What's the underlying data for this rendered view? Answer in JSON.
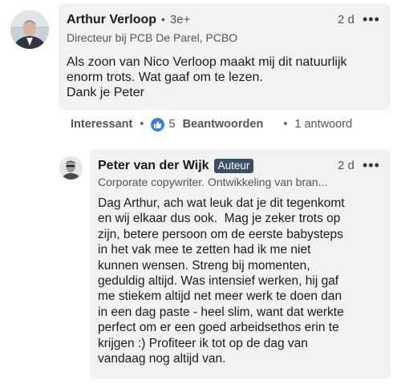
{
  "comment": {
    "author": "Arthur Verloop",
    "separator": "•",
    "degree": "3e+",
    "time": "2 d",
    "more": "•••",
    "headline": "Directeur bij PCB De Parel, PCBO",
    "text": "Als zoon van Nico Verloop maakt mij dit natuurlijk\nenorm trots. Wat gaaf om te lezen.\nDank je Peter",
    "actions": {
      "react_label": "Interessant",
      "reaction_count": "5",
      "reply_label": "Beantwoorden",
      "replies_label": "1 antwoord",
      "dot": "•"
    }
  },
  "reply": {
    "author": "Peter van der Wijk",
    "badge": "Auteur",
    "time": "2 d",
    "more": "•••",
    "headline": "Corporate copywriter. Ontwikkeling van bran...",
    "lines": [
      "Dag Arthur, ach wat leuk dat je dit tegenkomt",
      "en wij elkaar dus ook.  Mag je zeker trots op",
      "zijn, betere persoon om de eerste babysteps",
      "in het vak mee te zetten had ik me niet",
      "kunnen wensen. Streng bij momenten,",
      "geduldig altijd. Was intensief werken, hij gaf",
      "me stiekem altijd net meer werk te doen dan",
      "in een dag paste - heel slim, want dat werkte",
      "perfect om er een goed arbeidsethos erin te",
      "krijgen :) Profiteer ik tot op de dag van",
      "vandaag nog altijd van."
    ]
  },
  "colors": {
    "bubble": "#f2f2f2",
    "badge": "#3a4f66",
    "like": "#3b7fd8"
  }
}
